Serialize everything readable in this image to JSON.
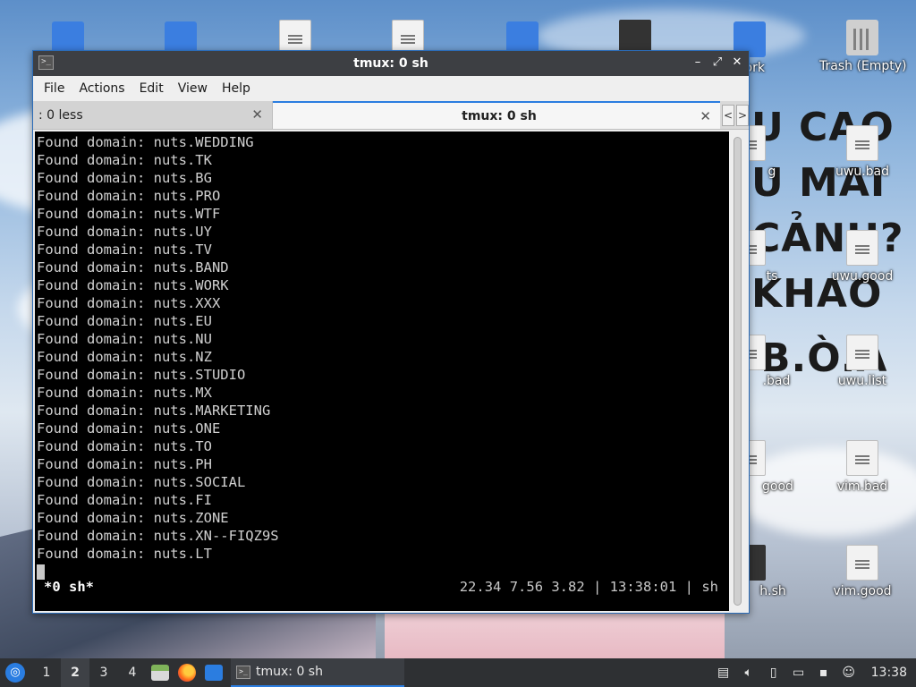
{
  "window": {
    "title": "tmux: 0 sh",
    "controls": {
      "minimize": "–",
      "maximize": "⤢",
      "close": "✕"
    }
  },
  "menubar": [
    "File",
    "Actions",
    "Edit",
    "View",
    "Help"
  ],
  "tabs": [
    {
      "label": ": 0 less",
      "close": "✕",
      "active": false
    },
    {
      "label": "tmux: 0 sh",
      "close": "✕",
      "active": true
    }
  ],
  "tab_scroll": {
    "left": "<",
    "right": ">"
  },
  "terminal": {
    "lines": [
      "Found domain: nuts.WEDDING",
      "Found domain: nuts.TK",
      "Found domain: nuts.BG",
      "Found domain: nuts.PRO",
      "Found domain: nuts.WTF",
      "Found domain: nuts.UY",
      "Found domain: nuts.TV",
      "Found domain: nuts.BAND",
      "Found domain: nuts.WORK",
      "Found domain: nuts.XXX",
      "Found domain: nuts.EU",
      "Found domain: nuts.NU",
      "Found domain: nuts.NZ",
      "Found domain: nuts.STUDIO",
      "Found domain: nuts.MX",
      "Found domain: nuts.MARKETING",
      "Found domain: nuts.ONE",
      "Found domain: nuts.TO",
      "Found domain: nuts.PH",
      "Found domain: nuts.SOCIAL",
      "Found domain: nuts.FI",
      "Found domain: nuts.ZONE",
      "Found domain: nuts.XN--FIQZ9S",
      "Found domain: nuts.LT"
    ],
    "status_left": "*0 sh*",
    "status_right": "22.34 7.56 3.82 | 13:38:01 | sh"
  },
  "desktop": {
    "icons": [
      {
        "label": "work",
        "type": "folder"
      },
      {
        "label": "Trash (Empty)",
        "type": "trash"
      },
      {
        "label": "uwu.bad",
        "type": "doc"
      },
      {
        "label": "uwu.good",
        "type": "doc"
      },
      {
        "label": "uwu.list",
        "type": "doc"
      },
      {
        "label": "vim.bad",
        "type": "doc"
      },
      {
        "label": "vim.good",
        "type": "doc"
      },
      {
        "label": "g",
        "type": "doc"
      },
      {
        "label": "ts",
        "type": "doc"
      },
      {
        "label": ".bad",
        "type": "doc"
      },
      {
        "label": "good",
        "type": "doc"
      },
      {
        "label": "h.sh",
        "type": "script"
      }
    ],
    "wallpaper_text": [
      "U CAO",
      "U MAI",
      "CẢNH?",
      "KHAO",
      "B.Ò.A"
    ]
  },
  "taskbar": {
    "start": "◎",
    "workspaces": [
      "1",
      "2",
      "3",
      "4"
    ],
    "active_workspace": "2",
    "task": "tmux: 0 sh",
    "clock": "13:38",
    "tray_icons": [
      "clipboard-icon",
      "volume-icon",
      "notes-icon",
      "network-icon",
      "updates-icon",
      "user-icon"
    ]
  },
  "colors": {
    "accent": "#2b7de0",
    "titlebar": "#3d3f43",
    "terminal_bg": "#000000",
    "terminal_fg": "#d0d0d0",
    "taskbar": "#2e3033"
  }
}
